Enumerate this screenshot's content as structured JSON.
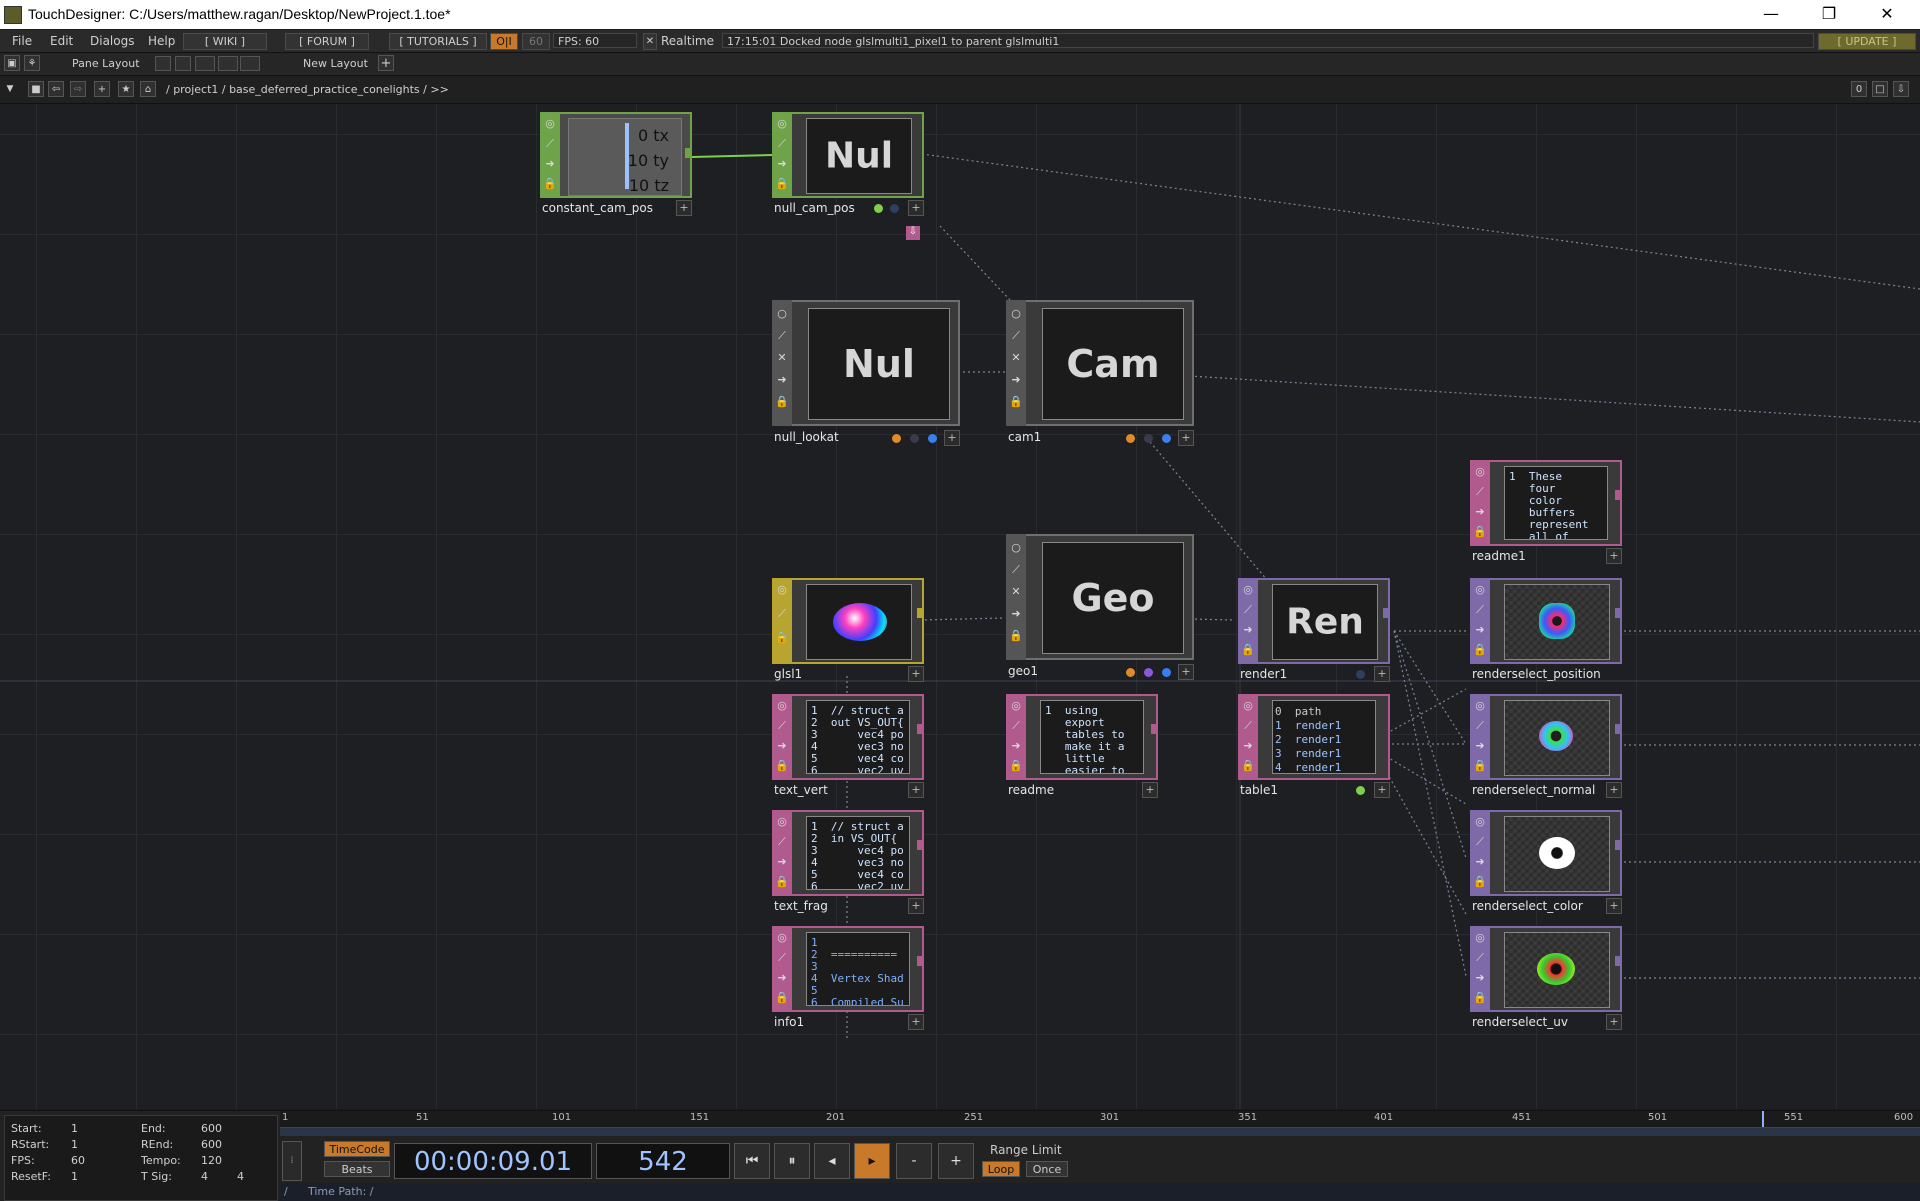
{
  "window": {
    "title": "TouchDesigner: C:/Users/matthew.ragan/Desktop/NewProject.1.toe*",
    "minimize": "—",
    "restore": "❐",
    "close": "✕"
  },
  "menu": {
    "items": [
      "File",
      "Edit",
      "Dialogs",
      "Help"
    ],
    "wiki": "[ WIKI ]",
    "forum": "[ FORUM ]",
    "tutorials": "[ TUTORIALS ]",
    "oi": "O|I",
    "fps_cap": "60",
    "fps": "FPS:  60",
    "realtime": "Realtime",
    "status": "17:15:01 Docked node glslmulti1_pixel1 to parent glslmulti1",
    "update": "[ UPDATE ]"
  },
  "toolbar": {
    "pane_layout": "Pane Layout",
    "new_layout": "New Layout",
    "add": "+"
  },
  "pathbar": {
    "path": "/ project1 / base_deferred_practice_conelights / >>",
    "zero": "0"
  },
  "nodes": {
    "constant_cam_pos": {
      "label": "constant_cam_pos",
      "vals": [
        "0",
        "10",
        "10"
      ],
      "chans": [
        "tx",
        "ty",
        "tz"
      ]
    },
    "null_cam_pos": {
      "label": "null_cam_pos",
      "text": "Nul"
    },
    "null_lookat": {
      "label": "null_lookat",
      "text": "Nul"
    },
    "cam1": {
      "label": "cam1",
      "text": "Cam"
    },
    "geo1": {
      "label": "geo1",
      "text": "Geo"
    },
    "render1": {
      "label": "render1",
      "text": "Ren"
    },
    "glsl1": {
      "label": "glsl1"
    },
    "text_vert": {
      "label": "text_vert",
      "lines": [
        "1  // struct a",
        "2  out VS_OUT{",
        "3      vec4 po",
        "4      vec3 no",
        "5      vec4 co",
        "6      vec2 uv"
      ]
    },
    "text_frag": {
      "label": "text_frag",
      "lines": [
        "1  // struct a",
        "2  in VS_OUT{",
        "3      vec4 po",
        "4      vec3 no",
        "5      vec4 co",
        "6      vec2 uv"
      ]
    },
    "info1": {
      "label": "info1",
      "lines": [
        "1",
        "2  ==========",
        "3",
        "4  Vertex Shad",
        "5",
        "6  Compiled Su"
      ]
    },
    "readme": {
      "label": "readme",
      "lines": [
        "1  using",
        "   export",
        "   tables to",
        "   make it a",
        "   little",
        "   easier to"
      ]
    },
    "readme1": {
      "label": "readme1",
      "lines": [
        "1  These",
        "   four",
        "   color",
        "   buffers",
        "   represent",
        "   all of"
      ]
    },
    "table1": {
      "label": "table1",
      "rows": [
        "path",
        "render1",
        "render1",
        "render1",
        "render1"
      ],
      "idx": [
        "0",
        "1",
        "2",
        "3",
        "4"
      ]
    },
    "renderselect_position": {
      "label": "renderselect_position"
    },
    "renderselect_normal": {
      "label": "renderselect_normal"
    },
    "renderselect_color": {
      "label": "renderselect_color"
    },
    "renderselect_uv": {
      "label": "renderselect_uv"
    }
  },
  "timeline": {
    "start_k": "Start:",
    "start_v": "1",
    "end_k": "End:",
    "end_v": "600",
    "rstart_k": "RStart:",
    "rstart_v": "1",
    "rend_k": "REnd:",
    "rend_v": "600",
    "fps_k": "FPS:",
    "fps_v": "60",
    "tempo_k": "Tempo:",
    "tempo_v": "120",
    "resetf_k": "ResetF:",
    "resetf_v": "1",
    "tsig_k": "T Sig:",
    "tsig_v1": "4",
    "tsig_v2": "4",
    "ticks": [
      "1",
      "51",
      "101",
      "151",
      "201",
      "251",
      "301",
      "351",
      "401",
      "451",
      "501",
      "551",
      "600"
    ],
    "timecode_btn": "TimeCode",
    "beats_btn": "Beats",
    "timecode": "00:00:09.01",
    "frame": "542",
    "range_limit": "Range Limit",
    "loop": "Loop",
    "once": "Once",
    "time_path": "Time Path: /"
  },
  "colors": {
    "chop": "#6fa34a",
    "comp": "#6f6f6f",
    "mat": "#b8a530",
    "dat": "#b05a8e",
    "top": "#7e6aa8",
    "accent": "#c87a2a"
  }
}
